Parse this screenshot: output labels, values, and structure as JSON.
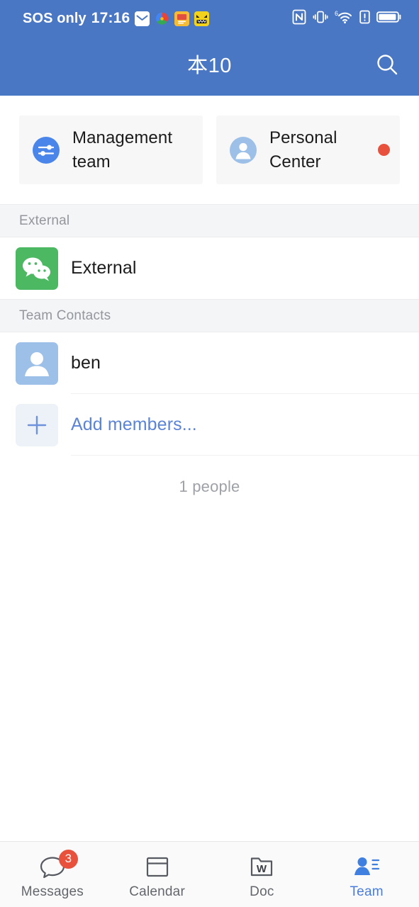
{
  "statusbar": {
    "carrier": "SOS only",
    "time": "17:16",
    "left_icons": [
      "mail-icon",
      "photos-icon",
      "app-icon-yellow",
      "emoji-icon"
    ],
    "right_icons": [
      "nfc-icon",
      "vibrate-icon",
      "wifi-6-icon",
      "alert-icon",
      "battery-icon"
    ]
  },
  "header": {
    "title": "本10",
    "search_icon": "search-icon",
    "background_color": "#4a77c4"
  },
  "quick_cards": [
    {
      "label": "Management team",
      "icon": "sliders-icon",
      "icon_color": "#4a86ea",
      "has_dot": false
    },
    {
      "label": "Personal Center",
      "icon": "person-circle-icon",
      "icon_color": "#9dc0e8",
      "has_dot": true,
      "dot_color": "#e8513c"
    }
  ],
  "sections": [
    {
      "header": "External",
      "rows": [
        {
          "label": "External",
          "icon": "wechat-icon",
          "style": "normal",
          "divider": false
        }
      ]
    },
    {
      "header": "Team Contacts",
      "rows": [
        {
          "label": "ben",
          "icon": "person-icon",
          "style": "normal",
          "divider": true
        },
        {
          "label": "Add members...",
          "icon": "plus-icon",
          "style": "link",
          "divider": true
        }
      ],
      "footer_note": "1 people"
    }
  ],
  "tabbar": {
    "tabs": [
      {
        "label": "Messages",
        "icon": "chat-bubble-icon",
        "badge": "3",
        "active": false
      },
      {
        "label": "Calendar",
        "icon": "calendar-icon",
        "badge": null,
        "active": false
      },
      {
        "label": "Doc",
        "icon": "doc-folder-w-icon",
        "badge": null,
        "active": false
      },
      {
        "label": "Team",
        "icon": "team-person-icon",
        "badge": null,
        "active": true
      }
    ],
    "active_color": "#4a7ddb",
    "badge_color": "#e8513c"
  }
}
